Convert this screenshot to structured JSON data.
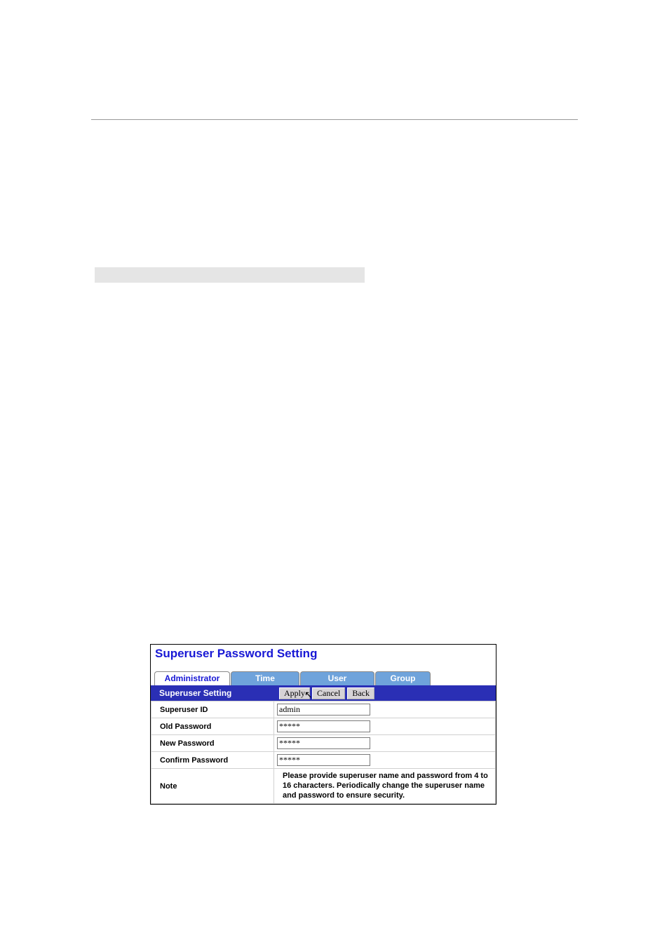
{
  "panel": {
    "title": "Superuser Password Setting"
  },
  "tabs": {
    "administrator": "Administrator",
    "time": "Time",
    "user": "User",
    "group": "Group"
  },
  "section": {
    "heading": "Superuser Setting",
    "apply": "Apply",
    "cancel": "Cancel",
    "back": "Back"
  },
  "fields": {
    "superuser_id": {
      "label": "Superuser ID",
      "value": "admin"
    },
    "old_password": {
      "label": "Old Password",
      "value": "*****"
    },
    "new_password": {
      "label": "New Password",
      "value": "*****"
    },
    "confirm_password": {
      "label": "Confirm Password",
      "value": "*****"
    }
  },
  "note": {
    "label": "Note",
    "text": "Please provide superuser name and password from 4 to 16 characters. Periodically change the superuser name and password to ensure security."
  }
}
